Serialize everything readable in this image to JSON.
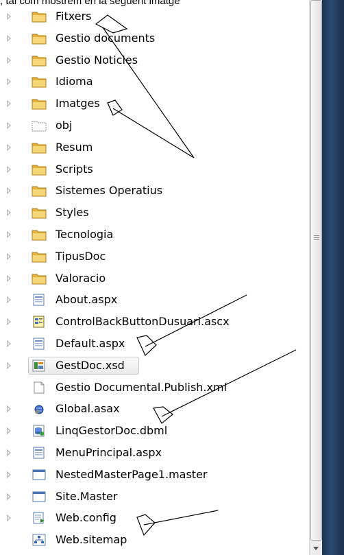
{
  "caption": ", tal com mostrem en la següent imatge",
  "items": [
    {
      "label": "Fitxers",
      "icon": "folder-icon",
      "expander": true
    },
    {
      "label": "Gestio documents",
      "icon": "folder-icon",
      "expander": true
    },
    {
      "label": "Gestio Noticies",
      "icon": "folder-icon",
      "expander": true
    },
    {
      "label": "Idioma",
      "icon": "folder-icon",
      "expander": true
    },
    {
      "label": "Imatges",
      "icon": "folder-icon",
      "expander": true
    },
    {
      "label": "obj",
      "icon": "hidden-folder-icon",
      "expander": true
    },
    {
      "label": "Resum",
      "icon": "folder-icon",
      "expander": true
    },
    {
      "label": "Scripts",
      "icon": "folder-icon",
      "expander": true
    },
    {
      "label": "Sistemes Operatius",
      "icon": "folder-icon",
      "expander": true
    },
    {
      "label": "Styles",
      "icon": "folder-icon",
      "expander": true
    },
    {
      "label": "Tecnologia",
      "icon": "folder-icon",
      "expander": true
    },
    {
      "label": "TipusDoc",
      "icon": "folder-icon",
      "expander": true
    },
    {
      "label": "Valoracio",
      "icon": "folder-icon",
      "expander": true
    },
    {
      "label": "About.aspx",
      "icon": "aspx-file-icon",
      "expander": true
    },
    {
      "label": "ControlBackButtonDusuari.ascx",
      "icon": "user-control-icon",
      "expander": true
    },
    {
      "label": "Default.aspx",
      "icon": "aspx-file-icon",
      "expander": true
    },
    {
      "label": "GestDoc.xsd",
      "icon": "dataset-icon",
      "expander": true,
      "selected": true
    },
    {
      "label": "Gestio Documental.Publish.xml",
      "icon": "file-icon",
      "expander": false
    },
    {
      "label": "Global.asax",
      "icon": "global-asax-icon",
      "expander": true
    },
    {
      "label": "LinqGestorDoc.dbml",
      "icon": "dbml-icon",
      "expander": true
    },
    {
      "label": "MenuPrincipal.aspx",
      "icon": "aspx-file-icon",
      "expander": true
    },
    {
      "label": "NestedMasterPage1.master",
      "icon": "master-page-icon",
      "expander": true
    },
    {
      "label": "Site.Master",
      "icon": "master-page-icon",
      "expander": true
    },
    {
      "label": "Web.config",
      "icon": "config-icon",
      "expander": true
    },
    {
      "label": "Web.sitemap",
      "icon": "sitemap-icon",
      "expander": false
    }
  ]
}
